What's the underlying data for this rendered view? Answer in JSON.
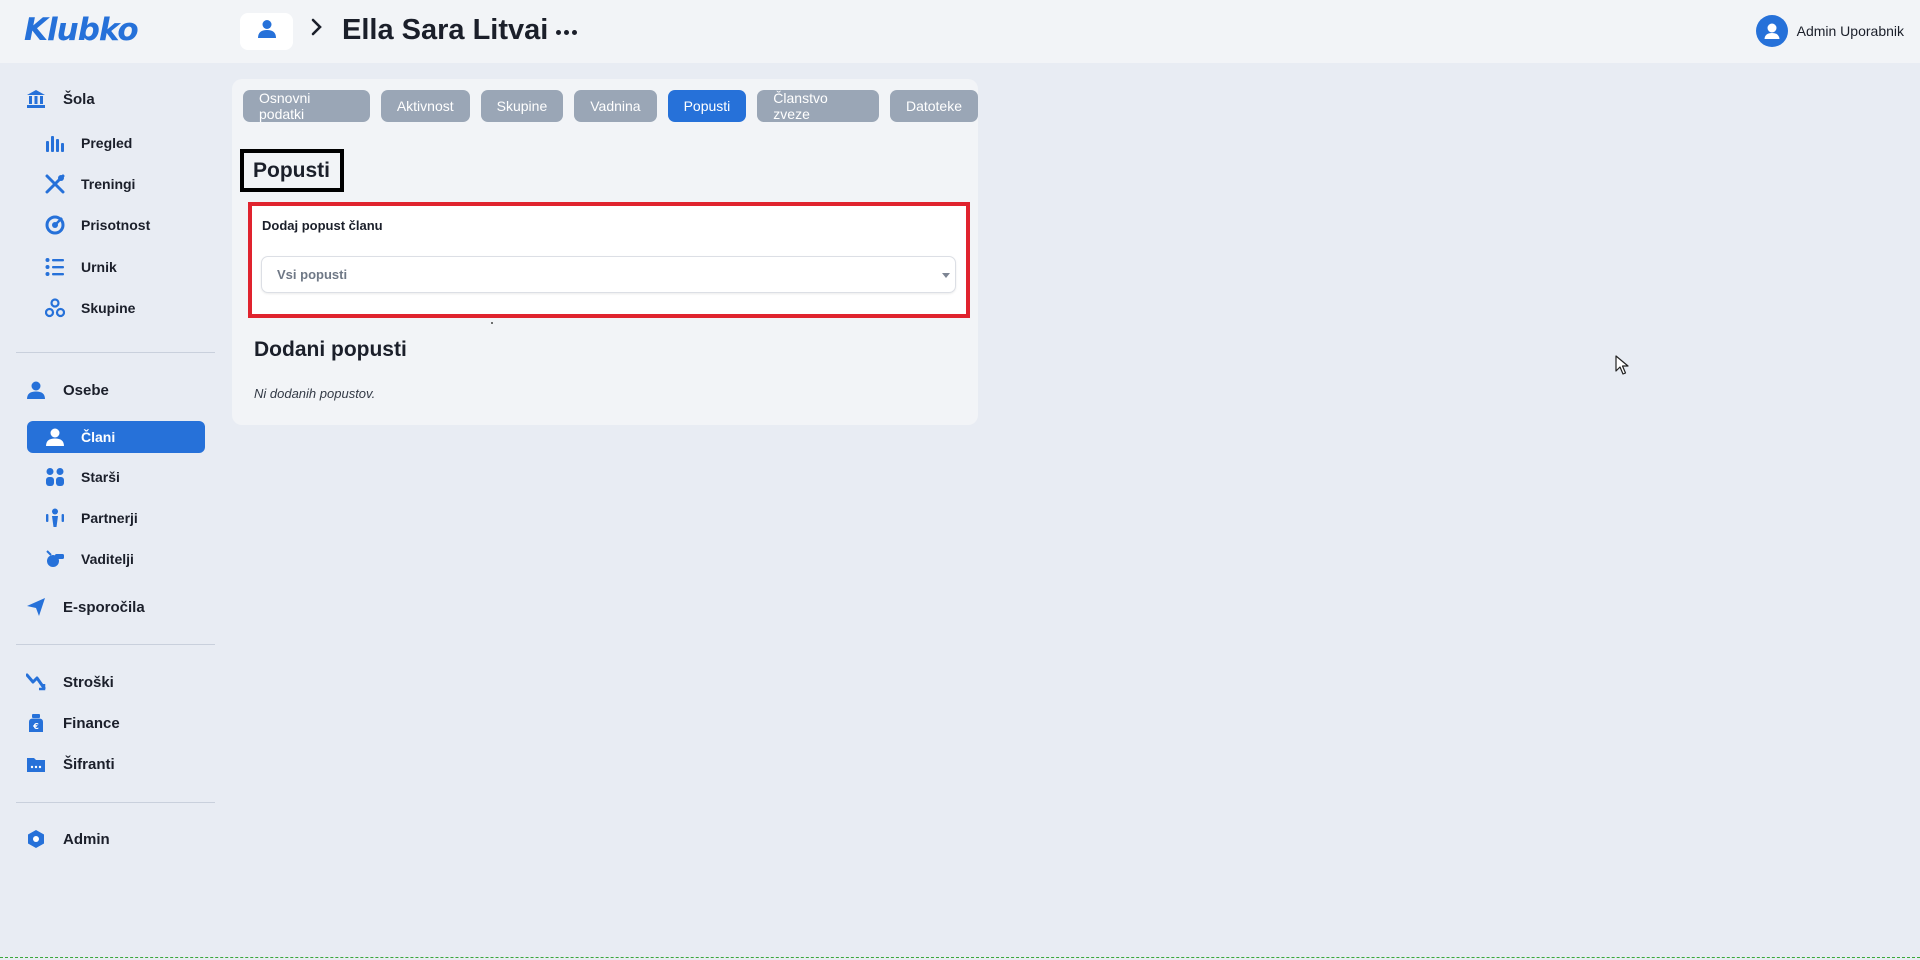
{
  "app": {
    "logo": "Klubko"
  },
  "header": {
    "title": "Ella Sara Litvai",
    "breadcrumb_icon": "person-icon",
    "user_name": "Admin Uporabnik"
  },
  "sidebar": {
    "sections": [
      {
        "label": "Šola",
        "icon": "school-icon"
      },
      {
        "label": "Osebe",
        "icon": "person-icon"
      },
      {
        "label": "E-sporočila",
        "icon": "send-icon"
      },
      {
        "label": "Stroški",
        "icon": "trend-icon"
      },
      {
        "label": "Finance",
        "icon": "money-bag-icon"
      },
      {
        "label": "Šifranti",
        "icon": "folder-icon"
      },
      {
        "label": "Admin",
        "icon": "hexagon-icon"
      }
    ],
    "school_items": [
      {
        "label": "Pregled",
        "icon": "bar-chart-icon"
      },
      {
        "label": "Treningi",
        "icon": "tools-icon"
      },
      {
        "label": "Prisotnost",
        "icon": "target-icon"
      },
      {
        "label": "Urnik",
        "icon": "list-icon"
      },
      {
        "label": "Skupine",
        "icon": "group-icon"
      }
    ],
    "people_items": [
      {
        "label": "Člani",
        "icon": "person-icon",
        "active": true
      },
      {
        "label": "Starši",
        "icon": "parents-icon"
      },
      {
        "label": "Partnerji",
        "icon": "partners-icon"
      },
      {
        "label": "Vaditelji",
        "icon": "whistle-icon"
      }
    ]
  },
  "tabs": [
    {
      "label": "Osnovni podatki"
    },
    {
      "label": "Aktivnost"
    },
    {
      "label": "Skupine"
    },
    {
      "label": "Vadnina"
    },
    {
      "label": "Popusti",
      "active": true
    },
    {
      "label": "Članstvo zveze"
    },
    {
      "label": "Datoteke"
    }
  ],
  "discounts": {
    "section_title": "Popusti",
    "add_label": "Dodaj popust članu",
    "select_value": "Vsi popusti",
    "added_title": "Dodani popusti",
    "empty_text": "Ni dodanih popustov."
  },
  "colors": {
    "accent": "#2671d9",
    "tab_inactive": "#9aa6b6",
    "highlight_border": "#e0232e",
    "background": "#e8ecf3"
  }
}
